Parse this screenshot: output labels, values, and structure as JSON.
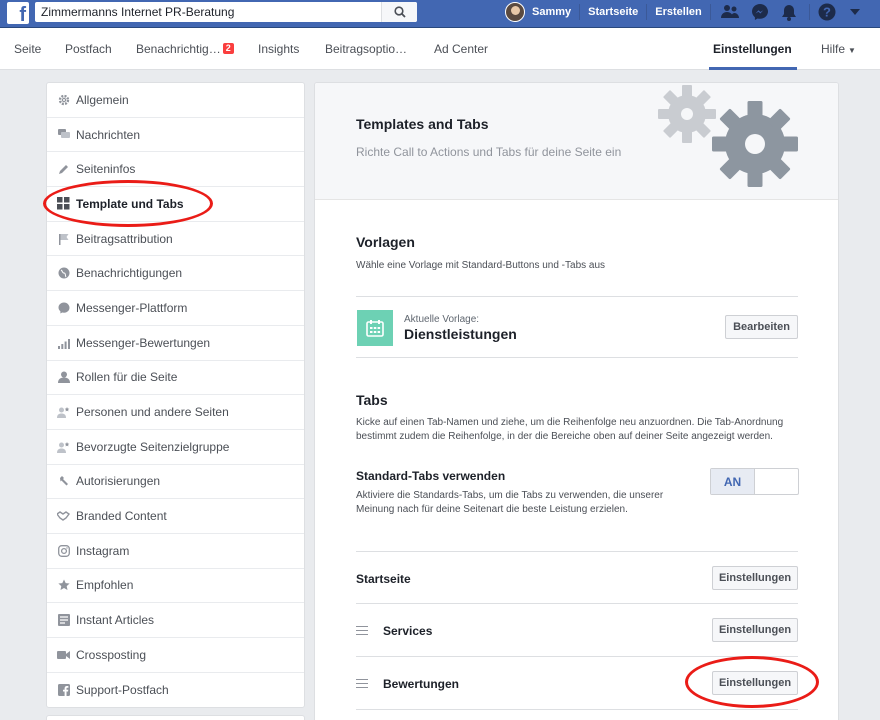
{
  "topbar": {
    "search_value": "Zimmermanns Internet PR-Beratung",
    "user_name": "Sammy",
    "home_label": "Startseite",
    "create_label": "Erstellen"
  },
  "page_tabs": [
    {
      "label": "Seite"
    },
    {
      "label": "Postfach"
    },
    {
      "label": "Benachrichtig…",
      "badge": "2"
    },
    {
      "label": "Insights"
    },
    {
      "label": "Beitragsoptio…"
    },
    {
      "label": "Ad Center"
    },
    {
      "label": "Einstellungen",
      "active": true
    },
    {
      "label": "Hilfe"
    }
  ],
  "sidebar": {
    "items": [
      {
        "label": "Allgemein",
        "icon": "gear-icon"
      },
      {
        "label": "Nachrichten",
        "icon": "chat-icon"
      },
      {
        "label": "Seiteninfos",
        "icon": "pencil-icon"
      },
      {
        "label": "Template und Tabs",
        "icon": "grid-icon",
        "active": true
      },
      {
        "label": "Beitragsattribution",
        "icon": "flag-icon"
      },
      {
        "label": "Benachrichtigungen",
        "icon": "globe-icon"
      },
      {
        "label": "Messenger-Plattform",
        "icon": "messenger-icon"
      },
      {
        "label": "Messenger-Bewertungen",
        "icon": "signal-bars-icon"
      },
      {
        "label": "Rollen für die Seite",
        "icon": "person-icon"
      },
      {
        "label": "Personen und andere Seiten",
        "icon": "person-star-icon"
      },
      {
        "label": "Bevorzugte Seitenzielgruppe",
        "icon": "person-star-icon"
      },
      {
        "label": "Autorisierungen",
        "icon": "wrench-icon"
      },
      {
        "label": "Branded Content",
        "icon": "handshake-icon"
      },
      {
        "label": "Instagram",
        "icon": "instagram-icon"
      },
      {
        "label": "Empfohlen",
        "icon": "star-icon"
      },
      {
        "label": "Instant Articles",
        "icon": "article-icon"
      },
      {
        "label": "Crossposting",
        "icon": "video-icon"
      },
      {
        "label": "Support-Postfach",
        "icon": "facebook-icon"
      }
    ]
  },
  "main": {
    "title": "Templates and Tabs",
    "subtitle": "Richte Call to Actions und Tabs für deine Seite ein",
    "templates": {
      "title": "Vorlagen",
      "desc": "Wähle eine Vorlage mit Standard-Buttons und -Tabs aus",
      "current_label": "Aktuelle Vorlage:",
      "current_name": "Dienstleistungen",
      "edit_label": "Bearbeiten"
    },
    "tabs": {
      "title": "Tabs",
      "desc": "Kicke auf einen Tab-Namen und ziehe, um die Reihenfolge neu anzuordnen. Die Tab-Anordnung bestimmt zudem die Reihenfolge, in der die Bereiche oben auf deiner Seite angezeigt werden.",
      "standard_title": "Standard-Tabs verwenden",
      "standard_desc": "Aktiviere die Standards-Tabs, um die Tabs zu verwenden, die unserer Meinung nach für deine Seitenart die beste Leistung erzielen.",
      "toggle_label": "AN",
      "rows": [
        {
          "label": "Startseite",
          "button": "Einstellungen"
        },
        {
          "label": "Services",
          "button": "Einstellungen"
        },
        {
          "label": "Bewertungen",
          "button": "Einstellungen"
        }
      ]
    }
  },
  "colors": {
    "brand": "#4267b2",
    "annotation": "#ea1c17",
    "template_icon": "#6dd1b4"
  }
}
